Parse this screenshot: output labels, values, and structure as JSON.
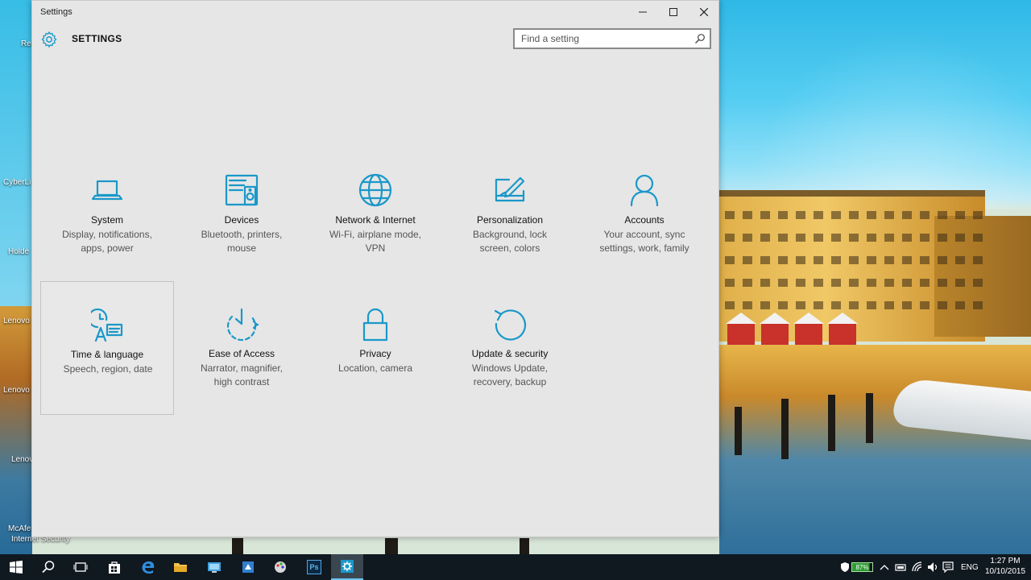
{
  "desktop": {
    "labels": [
      "Rec",
      "CyberLi",
      "Holde",
      "Lenovo",
      "Lenovo",
      "Lenovo",
      "McAfe",
      "Internet Security"
    ]
  },
  "window": {
    "title": "Settings",
    "header_title": "SETTINGS",
    "search_placeholder": "Find a setting",
    "accent_color": "#1a98c9",
    "tiles": [
      {
        "name": "System",
        "desc_lines": [
          "Display, notifications,",
          "apps, power"
        ],
        "icon": "laptop-icon"
      },
      {
        "name": "Devices",
        "desc_lines": [
          "Bluetooth, printers,",
          "mouse"
        ],
        "icon": "keyboard-speaker-icon"
      },
      {
        "name": "Network & Internet",
        "desc_lines": [
          "Wi-Fi, airplane mode,",
          "VPN"
        ],
        "icon": "globe-icon"
      },
      {
        "name": "Personalization",
        "desc_lines": [
          "Background, lock",
          "screen, colors"
        ],
        "icon": "paintbrush-icon"
      },
      {
        "name": "Accounts",
        "desc_lines": [
          "Your account, sync",
          "settings, work, family"
        ],
        "icon": "person-icon"
      },
      {
        "name": "Time & language",
        "desc_lines": [
          "Speech, region, date"
        ],
        "icon": "clock-language-icon",
        "selected": true
      },
      {
        "name": "Ease of Access",
        "desc_lines": [
          "Narrator, magnifier,",
          "high contrast"
        ],
        "icon": "timer-icon"
      },
      {
        "name": "Privacy",
        "desc_lines": [
          "Location, camera"
        ],
        "icon": "lock-icon"
      },
      {
        "name": "Update & security",
        "desc_lines": [
          "Windows Update,",
          "recovery, backup"
        ],
        "icon": "refresh-icon"
      }
    ]
  },
  "taskbar": {
    "battery_percent": "87%",
    "language": "ENG",
    "time": "1:27 PM",
    "date": "10/10/2015",
    "photoshop_label": "Ps"
  }
}
